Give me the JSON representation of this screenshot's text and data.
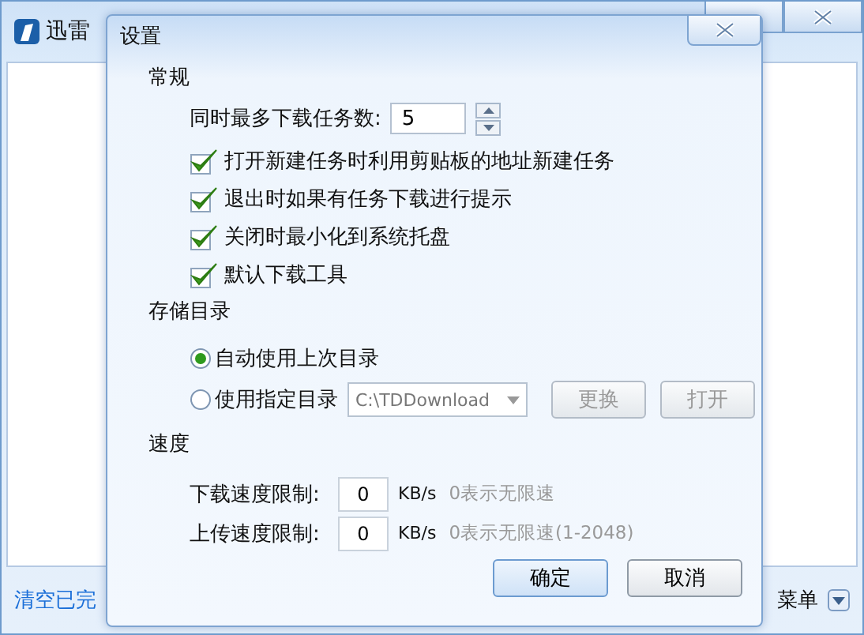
{
  "main_window": {
    "title": "迅雷",
    "clear_link": "清空已完",
    "menu_label": "菜单"
  },
  "dialog": {
    "title": "设置",
    "general": {
      "heading": "常规",
      "max_tasks_label": "同时最多下载任务数:",
      "max_tasks_value": "5",
      "options": [
        {
          "label": "打开新建任务时利用剪贴板的地址新建任务",
          "checked": true
        },
        {
          "label": "退出时如果有任务下载进行提示",
          "checked": true
        },
        {
          "label": "关闭时最小化到系统托盘",
          "checked": true
        },
        {
          "label": "默认下载工具",
          "checked": true
        }
      ]
    },
    "storage": {
      "heading": "存储目录",
      "choices": [
        {
          "label": "自动使用上次目录",
          "selected": true
        },
        {
          "label": "使用指定目录",
          "selected": false
        }
      ],
      "path": {
        "value": "C:\\TDDownload",
        "disabled": true
      },
      "actions": [
        {
          "label": "更换",
          "disabled": true
        },
        {
          "label": "打开",
          "disabled": true
        }
      ]
    },
    "speed": {
      "heading": "速度",
      "limits": [
        {
          "label": "下载速度限制:",
          "value": "0",
          "unit": "KB/s",
          "hint": "0表示无限速"
        },
        {
          "label": "上传速度限制:",
          "value": "0",
          "unit": "KB/s",
          "hint": "0表示无限速(1-2048)"
        }
      ]
    },
    "buttons": [
      {
        "label": "确定",
        "default": true
      },
      {
        "label": "取消",
        "default": false
      }
    ]
  }
}
